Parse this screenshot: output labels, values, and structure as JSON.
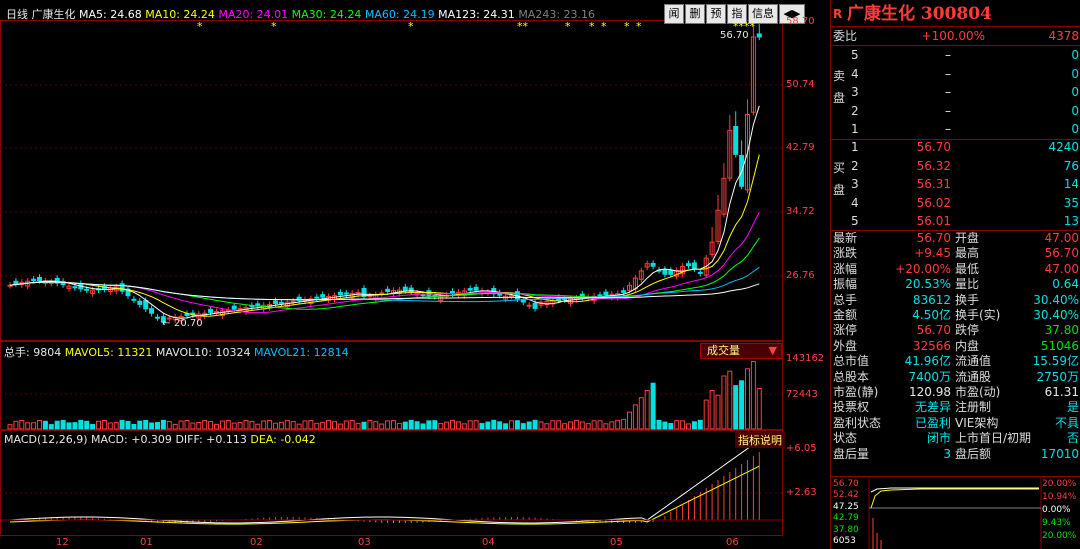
{
  "main_indicators": {
    "period": "日线",
    "name": "广康生化",
    "ma5": "MA5: 24.68",
    "ma10": "MA10: 24.24",
    "ma20": "MA20: 24.01",
    "ma30": "MA30: 24.24",
    "ma60": "MA60: 24.19",
    "ma123": "MA123: 24.31",
    "ma243": "MA243: 23.16"
  },
  "colors": {
    "up": "#ff3b3b",
    "down": "#00e0e0",
    "ma5": "#ffffff",
    "ma10": "#ffff00",
    "ma20": "#ff00ff",
    "ma30": "#00ff00",
    "ma60": "#00c0ff",
    "ma123": "#ffffff",
    "ma243": "#808080",
    "grid": "#8b0000"
  },
  "toolbar": {
    "b1": "闻",
    "b2": "删",
    "b3": "预",
    "b4": "指",
    "b5": "信息",
    "arrow": "◀▶"
  },
  "y_axis_price": [
    "58.70",
    "50.74",
    "42.79",
    "34.72",
    "26.76"
  ],
  "y_axis_volume": [
    "143162",
    "72443"
  ],
  "y_axis_macd": [
    "+6.05",
    "+2.63"
  ],
  "x_axis_months": [
    "12",
    "01",
    "02",
    "03",
    "04",
    "05",
    "06"
  ],
  "markers": {
    "high": "56.70",
    "low": "20.70",
    "stars": [
      "*",
      "*",
      "*",
      "**",
      "*",
      "*",
      "*",
      "*",
      "*",
      "****"
    ]
  },
  "volume_indicators": {
    "total": "总手: 9804",
    "mavol5": "MAVOL5: 11321",
    "mavol10": "MAVOL10: 10324",
    "mavol21": "MAVOL21: 12814",
    "dropdown": "成交量"
  },
  "macd_indicators": {
    "title": "MACD(12,26,9)",
    "macd": "MACD: +0.309",
    "diff": "DIFF: +0.113",
    "dea": "DEA: -0.042",
    "help": "指标说明"
  },
  "panel": {
    "title": "广康生化 300804",
    "weibi_label": "委比",
    "weibi_value": "+100.00%",
    "weibi_diff": "4378",
    "sell_label": "卖盘",
    "sell": [
      {
        "level": "5",
        "price": "–",
        "vol": "0"
      },
      {
        "level": "4",
        "price": "–",
        "vol": "0"
      },
      {
        "level": "3",
        "price": "–",
        "vol": "0"
      },
      {
        "level": "2",
        "price": "–",
        "vol": "0"
      },
      {
        "level": "1",
        "price": "–",
        "vol": "0"
      }
    ],
    "buy_label": "买盘",
    "buy": [
      {
        "level": "1",
        "price": "56.70",
        "vol": "4240"
      },
      {
        "level": "2",
        "price": "56.32",
        "vol": "76"
      },
      {
        "level": "3",
        "price": "56.31",
        "vol": "14"
      },
      {
        "level": "4",
        "price": "56.02",
        "vol": "35"
      },
      {
        "level": "5",
        "price": "56.01",
        "vol": "13"
      }
    ],
    "stats": [
      {
        "l1": "最新",
        "v1": "56.70",
        "c1": "red",
        "l2": "开盘",
        "v2": "47.00",
        "c2": "red"
      },
      {
        "l1": "涨跌",
        "v1": "+9.45",
        "c1": "red",
        "l2": "最高",
        "v2": "56.70",
        "c2": "red"
      },
      {
        "l1": "涨幅",
        "v1": "+20.00%",
        "c1": "red",
        "l2": "最低",
        "v2": "47.00",
        "c2": "red"
      },
      {
        "l1": "振幅",
        "v1": "20.53%",
        "c1": "cyan",
        "l2": "量比",
        "v2": "0.64",
        "c2": "cyan"
      },
      {
        "l1": "总手",
        "v1": "83612",
        "c1": "cyan",
        "l2": "换手",
        "v2": "30.40%",
        "c2": "cyan"
      },
      {
        "l1": "金额",
        "v1": "4.50亿",
        "c1": "cyan",
        "l2": "换手(实)",
        "v2": "30.40%",
        "c2": "cyan"
      },
      {
        "l1": "涨停",
        "v1": "56.70",
        "c1": "red",
        "l2": "跌停",
        "v2": "37.80",
        "c2": "green"
      },
      {
        "l1": "外盘",
        "v1": "32566",
        "c1": "red",
        "l2": "内盘",
        "v2": "51046",
        "c2": "green"
      },
      {
        "l1": "总市值",
        "v1": "41.96亿",
        "c1": "cyan",
        "l2": "流通值",
        "v2": "15.59亿",
        "c2": "cyan"
      },
      {
        "l1": "总股本",
        "v1": "7400万",
        "c1": "cyan",
        "l2": "流通股",
        "v2": "2750万",
        "c2": "cyan"
      },
      {
        "l1": "市盈(静)",
        "v1": "120.98",
        "c1": "white",
        "l2": "市盈(动)",
        "v2": "61.31",
        "c2": "white"
      },
      {
        "l1": "投票权",
        "v1": "无差异",
        "c1": "cyan",
        "l2": "注册制",
        "v2": "是",
        "c2": "cyan"
      },
      {
        "l1": "盈利状态",
        "v1": "已盈利",
        "c1": "cyan",
        "l2": "VIE架构",
        "v2": "不具",
        "c2": "cyan"
      },
      {
        "l1": "状态",
        "v1": "闭市",
        "c1": "cyan",
        "l2": "上市首日/初期",
        "v2": "否",
        "c2": "cyan"
      },
      {
        "l1": "盘后量",
        "v1": "3",
        "c1": "cyan",
        "l2": "盘后额",
        "v2": "17010",
        "c2": "cyan"
      }
    ],
    "mini_y_left": [
      "56.70",
      "52.42",
      "47.25",
      "42.79",
      "37.80",
      "6053"
    ],
    "mini_y_right": [
      "20.00%",
      "10.94%",
      "0.00%",
      "9.43%",
      "20.00%"
    ]
  }
}
